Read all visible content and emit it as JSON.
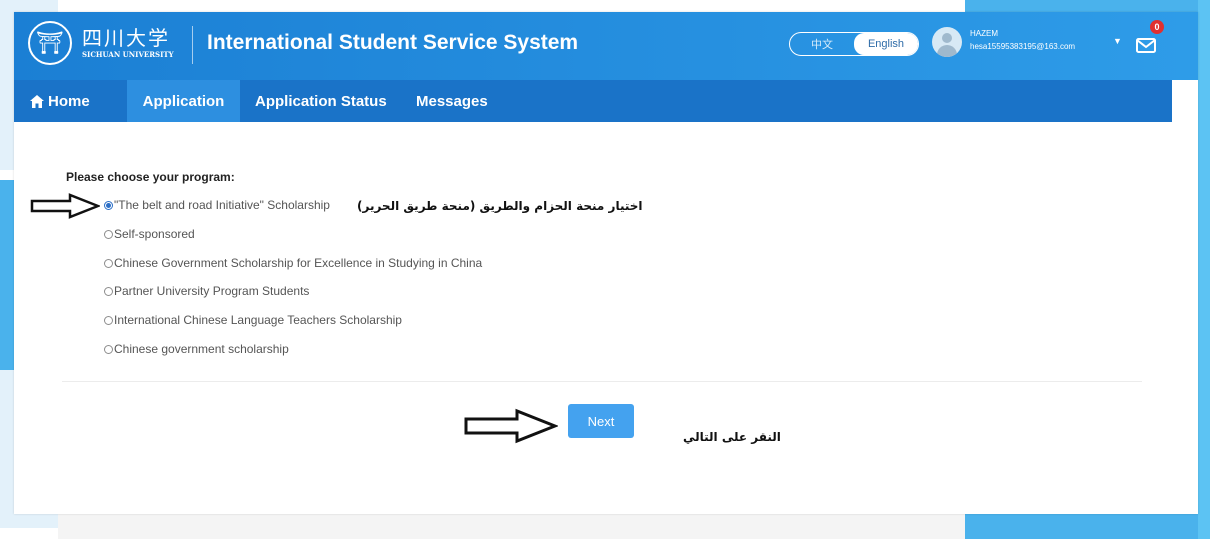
{
  "header": {
    "logo_cn": "四川大学",
    "logo_en": "SICHUAN UNIVERSITY",
    "title": "International Student Service System",
    "lang_zh": "中文",
    "lang_en": "English",
    "user_name": "HAZEM",
    "user_email": "hesa15595383195@163.com",
    "mail_badge": "0"
  },
  "nav": {
    "home": "Home",
    "application": "Application",
    "status": "Application Status",
    "messages": "Messages"
  },
  "form": {
    "prompt": "Please choose your program:",
    "options": [
      {
        "label": "\"The belt and road Initiative\" Scholarship",
        "checked": true
      },
      {
        "label": "Self-sponsored",
        "checked": false
      },
      {
        "label": "Chinese Government Scholarship for Excellence in Studying in China",
        "checked": false
      },
      {
        "label": "Partner University Program Students",
        "checked": false
      },
      {
        "label": "International Chinese Language Teachers Scholarship",
        "checked": false
      },
      {
        "label": "Chinese government scholarship",
        "checked": false
      }
    ],
    "next": "Next"
  },
  "annotations": {
    "choose_program": "اختيار منحة الحزام والطريق (منحة طريق الحرير)",
    "click_next": "النقر على التالي"
  },
  "colors": {
    "header": "#1b7fd4",
    "navbar": "#1a73c8",
    "nav_active": "#2d8fe0",
    "button": "#44a2ef",
    "decor_blue": "#4ab2ec"
  }
}
